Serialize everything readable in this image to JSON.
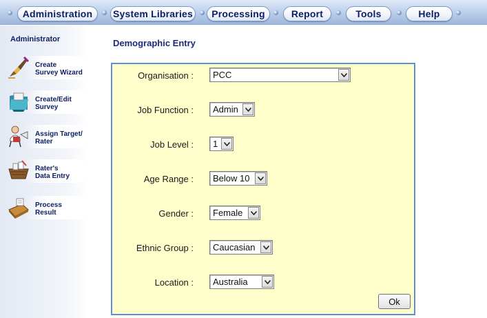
{
  "nav": {
    "tabs": [
      {
        "label": "Administration"
      },
      {
        "label": "System Libraries"
      },
      {
        "label": "Processing"
      },
      {
        "label": "Report"
      },
      {
        "label": "Tools"
      },
      {
        "label": "Help"
      }
    ]
  },
  "sidebar": {
    "title": "Administrator",
    "items": [
      {
        "label": "Create\nSurvey Wizard",
        "icon": "wizard-pen-icon"
      },
      {
        "label": "Create/Edit\nSurvey",
        "icon": "survey-folder-icon"
      },
      {
        "label": "Assign Target/\nRater",
        "icon": "target-person-icon"
      },
      {
        "label": "Rater's\nData Entry",
        "icon": "data-entry-basket-icon"
      },
      {
        "label": "Process\nResult",
        "icon": "calculator-icon"
      }
    ]
  },
  "page": {
    "title": "Demographic Entry"
  },
  "form": {
    "fields": [
      {
        "label": "Organisation :",
        "value": "PCC"
      },
      {
        "label": "Job Function :",
        "value": "Admin"
      },
      {
        "label": "Job Level :",
        "value": "1"
      },
      {
        "label": "Age Range :",
        "value": "Below 10"
      },
      {
        "label": "Gender :",
        "value": "Female"
      },
      {
        "label": "Ethnic Group :",
        "value": "Caucasian"
      },
      {
        "label": "Location :",
        "value": "Australia"
      }
    ],
    "ok_label": "Ok"
  },
  "colors": {
    "nav_text": "#0c1f63",
    "panel_bg": "#ffffcc",
    "panel_border": "#5c8fd6",
    "title": "#1b2a78"
  }
}
